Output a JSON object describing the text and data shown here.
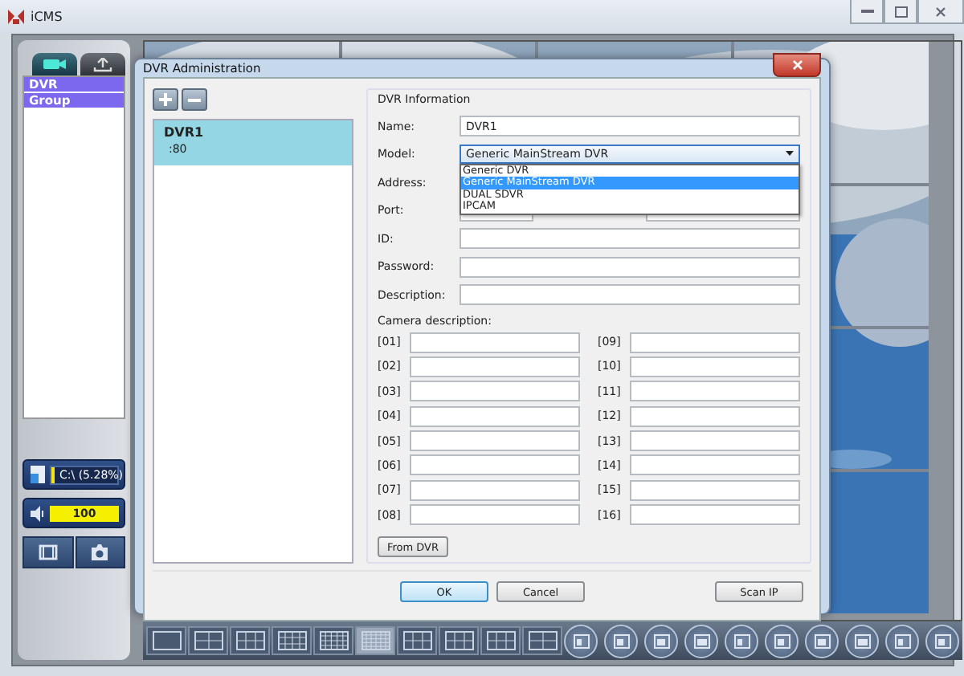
{
  "window": {
    "title": "iCMS"
  },
  "sidebar": {
    "tabs": [
      {
        "selected": true
      },
      {
        "selected": false
      }
    ],
    "tree": [
      {
        "label": "DVR"
      },
      {
        "label": "Group"
      }
    ],
    "disk": {
      "label": "C:\\ (5.28%)",
      "level": 0.06
    },
    "volume": {
      "reading": "100",
      "level": 1
    }
  },
  "layout_buttons": [
    {
      "selected": false
    },
    {
      "selected": false
    },
    {
      "selected": false
    },
    {
      "selected": false
    },
    {
      "selected": false
    },
    {
      "selected": true
    },
    {
      "selected": false
    },
    {
      "selected": false
    },
    {
      "selected": false
    },
    {
      "selected": false
    }
  ],
  "dialog": {
    "title": "DVR Administration",
    "dvr_list": [
      {
        "name": "DVR1",
        "port": ":80",
        "selected": true
      }
    ],
    "group_title": "DVR Information",
    "fields": [
      {
        "label": "Name:",
        "value": "DVR1"
      },
      {
        "label": "Model:",
        "kind": "combo",
        "value": "Generic MainStream DVR",
        "expanded": true,
        "options": [
          {
            "label": "Generic DVR",
            "selected": false
          },
          {
            "label": "Generic MainStream DVR",
            "selected": true
          },
          {
            "label": "DUAL SDVR",
            "selected": false
          },
          {
            "label": "IPCAM",
            "selected": false
          }
        ]
      },
      {
        "label": "Address:"
      },
      {
        "label": "Port:",
        "kind": "split"
      },
      {
        "label": "ID:"
      },
      {
        "label": "Password:"
      },
      {
        "label": "Description:"
      }
    ],
    "camera_title": "Camera description:",
    "cameras": [
      "[01]",
      "[02]",
      "[03]",
      "[04]",
      "[05]",
      "[06]",
      "[07]",
      "[08]",
      "[09]",
      "[10]",
      "[11]",
      "[12]",
      "[13]",
      "[14]",
      "[15]",
      "[16]"
    ],
    "from_button": "From DVR",
    "buttons": [
      {
        "label": "OK",
        "default": true
      },
      {
        "label": "Cancel",
        "default": false
      },
      {
        "label": "Scan IP",
        "default": false
      }
    ]
  }
}
